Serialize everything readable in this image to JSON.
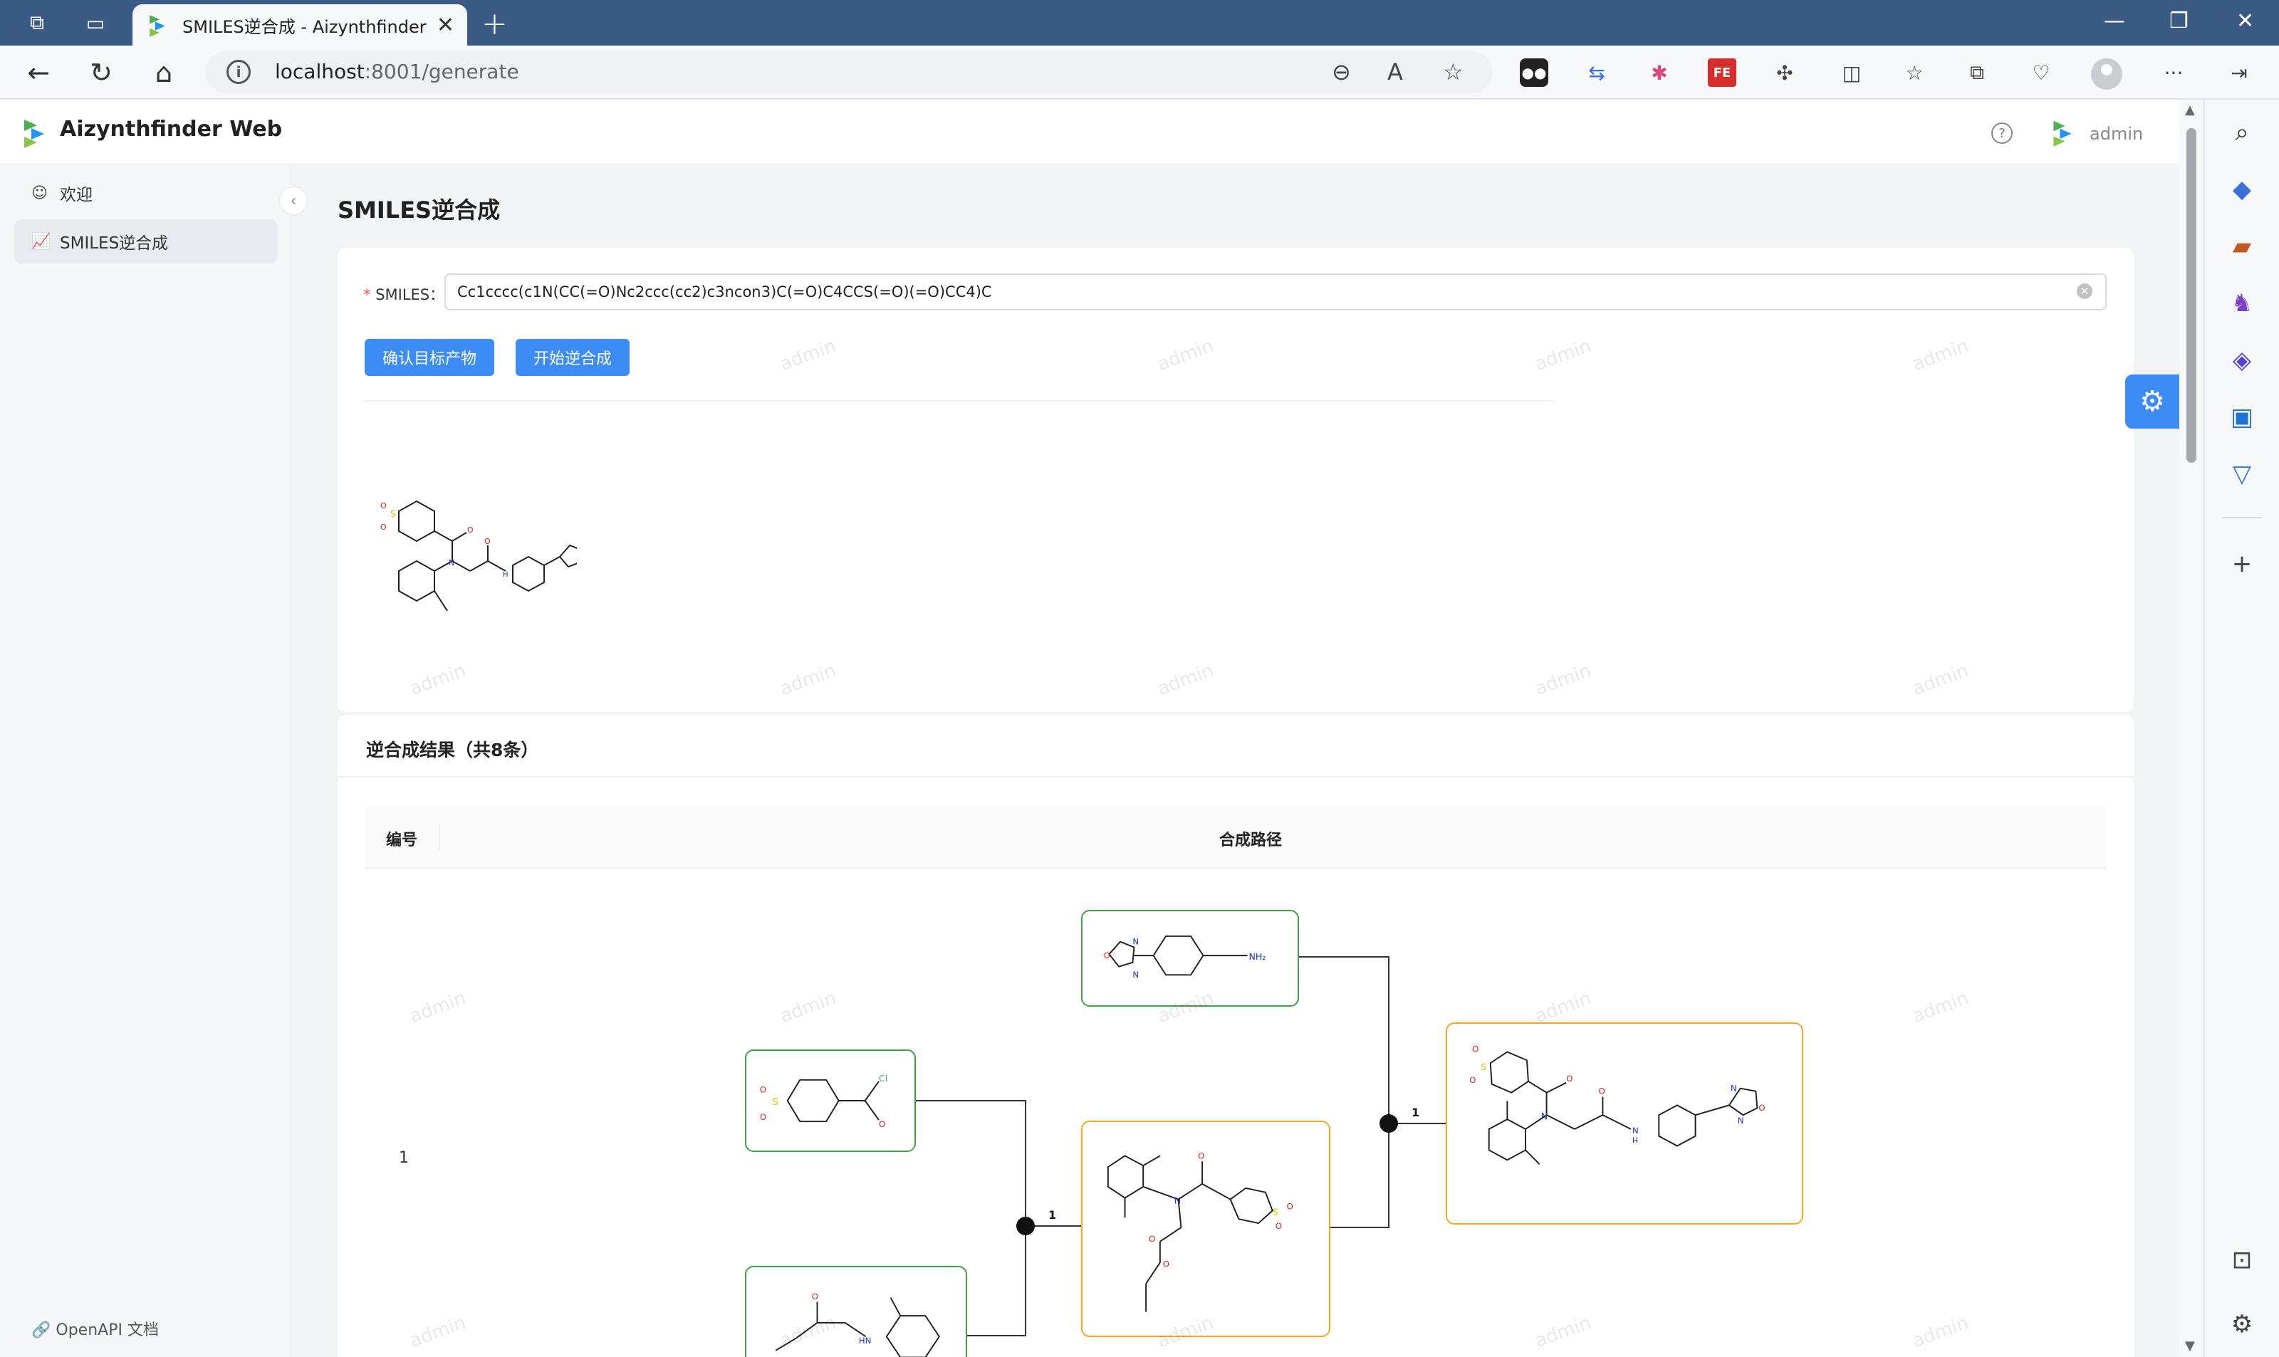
{
  "browser": {
    "tab_title": "SMILES逆合成 - Aizynthfinder W",
    "url_host": "localhost",
    "url_path": ":8001/generate"
  },
  "app": {
    "title": "Aizynthfinder Web",
    "user": "admin",
    "watermark": "admin"
  },
  "nav": {
    "items": [
      {
        "label": "欢迎",
        "icon": "smile-icon"
      },
      {
        "label": "SMILES逆合成",
        "icon": "chart-icon"
      }
    ],
    "footer_link": "OpenAPI 文档"
  },
  "page": {
    "title": "SMILES逆合成",
    "smiles_label": "SMILES",
    "smiles_value": "Cc1cccc(c1N(CC(=O)Nc2ccc(cc2)c3ncon3)C(=O)C4CCS(=O)(=O)CC4)C",
    "confirm_button": "确认目标产物",
    "start_button": "开始逆合成"
  },
  "results": {
    "title": "逆合成结果（共8条）",
    "col_number": "编号",
    "col_route": "合成路径",
    "rows": [
      {
        "number": "1",
        "reaction_label_1": "1",
        "reaction_label_2": "1"
      }
    ]
  },
  "colors": {
    "primary": "#3d8bf5",
    "stock_border": "#43a047",
    "intermediate_border": "#f5a623",
    "titlebar": "#3a5a83"
  }
}
